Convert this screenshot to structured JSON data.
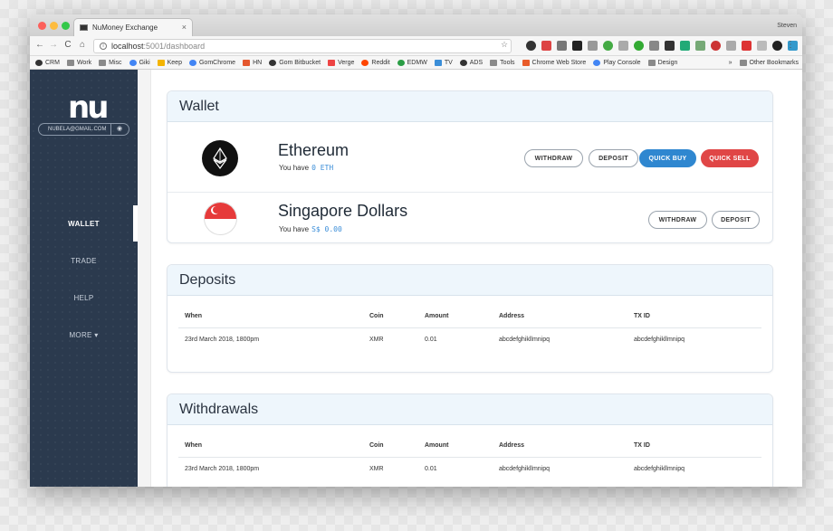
{
  "browser": {
    "tab_title": "NuMoney Exchange",
    "tab_close": "×",
    "user": "Steven",
    "url_host": "localhost",
    "url_path": ":5001/dashboard",
    "nav_back": "←",
    "nav_forward": "→",
    "nav_reload": "C",
    "nav_home": "⌂",
    "star": "☆",
    "menu": "⋮",
    "bookmarks": [
      "CRM",
      "Work",
      "Misc",
      "Giki",
      "Keep",
      "GomChrome",
      "HN",
      "Gom Bitbucket",
      "Verge",
      "Reddit",
      "EDMW",
      "TV",
      "ADS",
      "Tools",
      "Chrome Web Store",
      "Play Console",
      "Design"
    ],
    "bookmarks_more": "»",
    "other_bookmarks": "Other Bookmarks"
  },
  "sidebar": {
    "logo": "nu",
    "email": "NUBELA@GMAIL.COM",
    "bell": "🔔",
    "items": [
      {
        "label": "WALLET"
      },
      {
        "label": "TRADE"
      },
      {
        "label": "HELP"
      },
      {
        "label": "MORE ▾"
      }
    ]
  },
  "wallet": {
    "title": "Wallet",
    "rows": [
      {
        "name": "Ethereum",
        "have": "You have",
        "amount": "0 ETH"
      },
      {
        "name": "Singapore Dollars",
        "have": "You have",
        "amount": "S$ 0.00"
      }
    ],
    "buttons": {
      "withdraw": "WITHDRAW",
      "deposit": "DEPOSIT",
      "quick_buy": "QUICK BUY",
      "quick_sell": "QUICK SELL"
    }
  },
  "deposits": {
    "title": "Deposits",
    "headers": [
      "When",
      "Coin",
      "Amount",
      "Address",
      "TX ID"
    ],
    "rows": [
      [
        "23rd March 2018, 1800pm",
        "XMR",
        "0.01",
        "abcdefghikllmnipq",
        "abcdefghikllmnipq"
      ]
    ]
  },
  "withdrawals": {
    "title": "Withdrawals",
    "headers": [
      "When",
      "Coin",
      "Amount",
      "Address",
      "TX ID"
    ],
    "rows": [
      [
        "23rd March 2018, 1800pm",
        "XMR",
        "0.01",
        "abcdefghikllmnipq",
        "abcdefghikllmnipq"
      ]
    ]
  },
  "colors": {
    "sidebar": "#2b3a4e",
    "quick_buy": "#2f87d0",
    "quick_sell": "#e04646",
    "card_header": "#eef6fc"
  }
}
